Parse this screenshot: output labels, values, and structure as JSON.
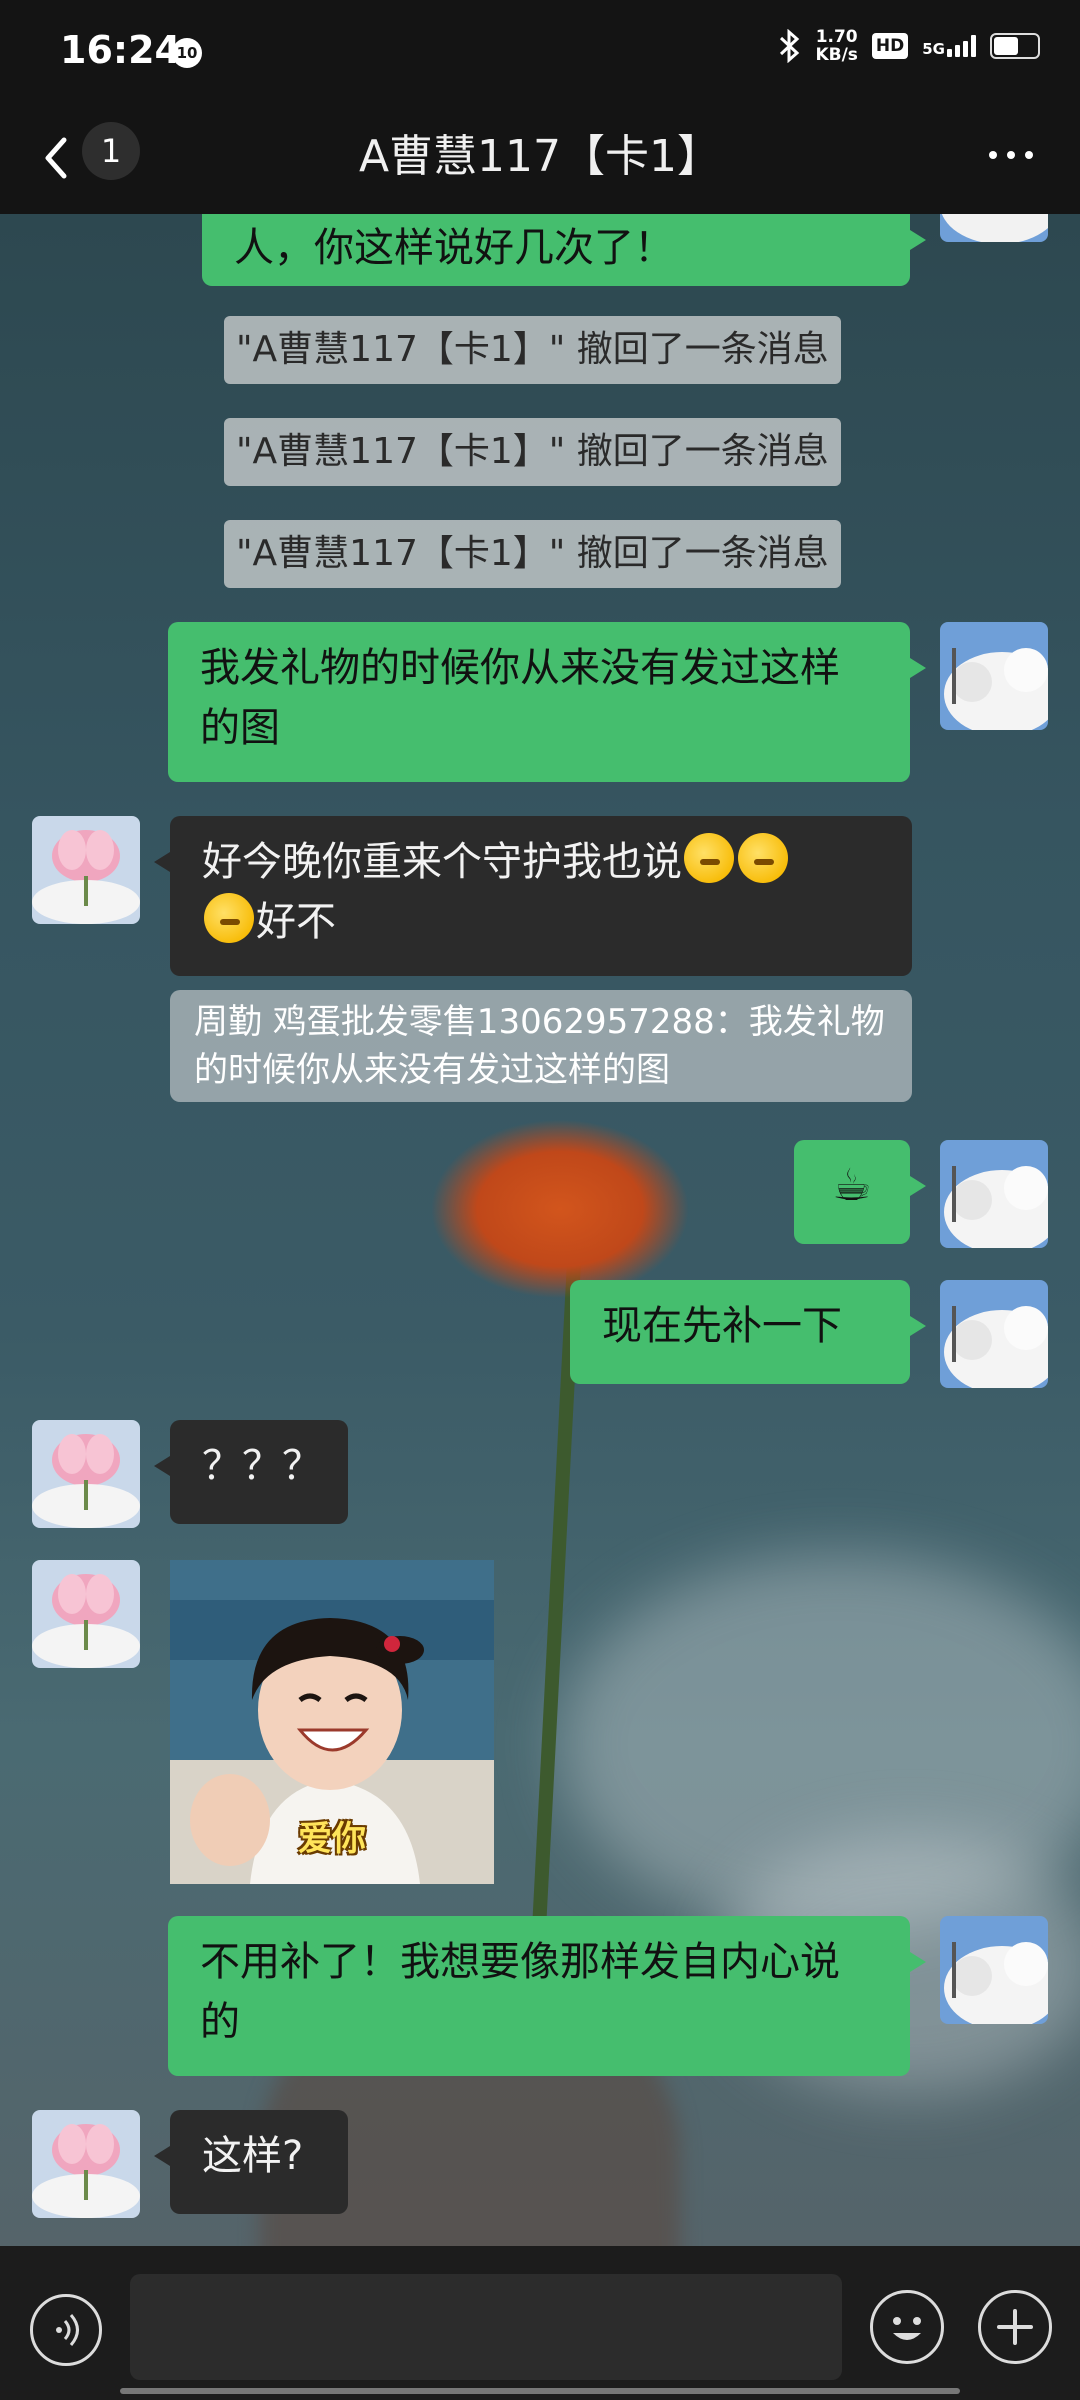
{
  "status_bar": {
    "time": "16:24",
    "notification_badge": "10",
    "net_speed_value": "1.70",
    "net_speed_unit": "KB/s",
    "hd_label": "HD",
    "network_type": "5G"
  },
  "header": {
    "back_count": "1",
    "title": "A曹慧117【卡1】"
  },
  "messages": {
    "m1": "人，你这样说好几次了！",
    "recall_1": "\"A曹慧117【卡1】\" 撤回了一条消息",
    "recall_2": "\"A曹慧117【卡1】\" 撤回了一条消息",
    "recall_3": "\"A曹慧117【卡1】\" 撤回了一条消息",
    "m2": "我发礼物的时候你从来没有发过这样的图",
    "m3_text": "好今晚你重来个守护我也说",
    "m3_tail": "好不",
    "quote": "周勤 鸡蛋批发零售13062957288：我发礼物的时候你从来没有发过这样的图",
    "m4_emoji": "☕",
    "m5": "现在先补一下",
    "m6": "？？？",
    "photo_caption": "爱你",
    "m7": "不用补了！我想要像那样发自内心说的",
    "m8": "这样?"
  },
  "input": {
    "placeholder": ""
  },
  "colors": {
    "outgoing_bubble": "#45be6e",
    "incoming_bubble": "#2b2b2b",
    "header_bg": "#141414"
  },
  "icons": {
    "back": "chevron-left-icon",
    "more": "more-dots-icon",
    "voice": "voice-icon",
    "emoji": "emoji-icon",
    "plus": "plus-icon"
  }
}
